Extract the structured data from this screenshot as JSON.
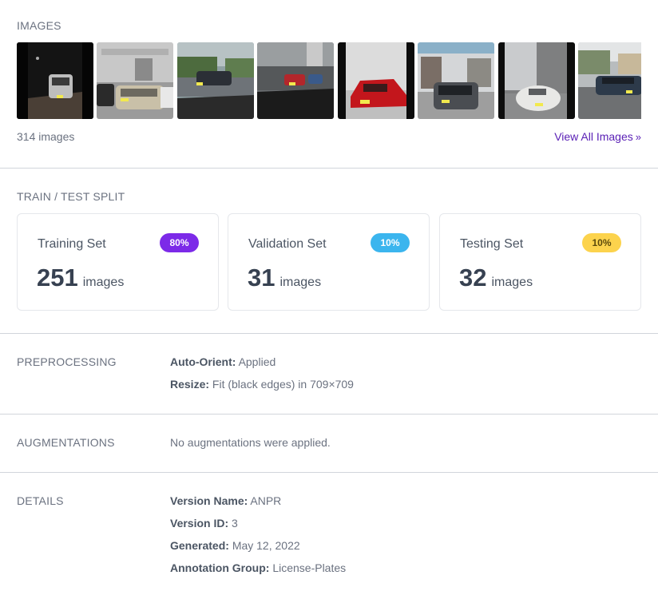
{
  "images": {
    "section_title": "IMAGES",
    "count_text": "314 images",
    "view_all_label": "View All Images",
    "view_all_icon": "double-chevron-right-icon"
  },
  "split": {
    "section_title": "TRAIN / TEST SPLIT",
    "cards": [
      {
        "title": "Training Set",
        "badge": "80%",
        "count": "251",
        "unit": "images",
        "badge_color": "#7c2ae8"
      },
      {
        "title": "Validation Set",
        "badge": "10%",
        "count": "31",
        "unit": "images",
        "badge_color": "#3bb5ee"
      },
      {
        "title": "Testing Set",
        "badge": "10%",
        "count": "32",
        "unit": "images",
        "badge_color": "#fcd34d"
      }
    ]
  },
  "preprocessing": {
    "section_title": "PREPROCESSING",
    "items": [
      {
        "label": "Auto-Orient:",
        "value": "Applied"
      },
      {
        "label": "Resize:",
        "value": "Fit (black edges) in 709×709"
      }
    ]
  },
  "augmentations": {
    "section_title": "AUGMENTATIONS",
    "text": "No augmentations were applied."
  },
  "details": {
    "section_title": "DETAILS",
    "items": [
      {
        "label": "Version Name:",
        "value": "ANPR"
      },
      {
        "label": "Version ID:",
        "value": "3"
      },
      {
        "label": "Generated:",
        "value": "May 12, 2022"
      },
      {
        "label": "Annotation Group:",
        "value": "License-Plates"
      }
    ]
  },
  "colors": {
    "accent": "#5b21b6",
    "divider": "#d1d5db"
  }
}
